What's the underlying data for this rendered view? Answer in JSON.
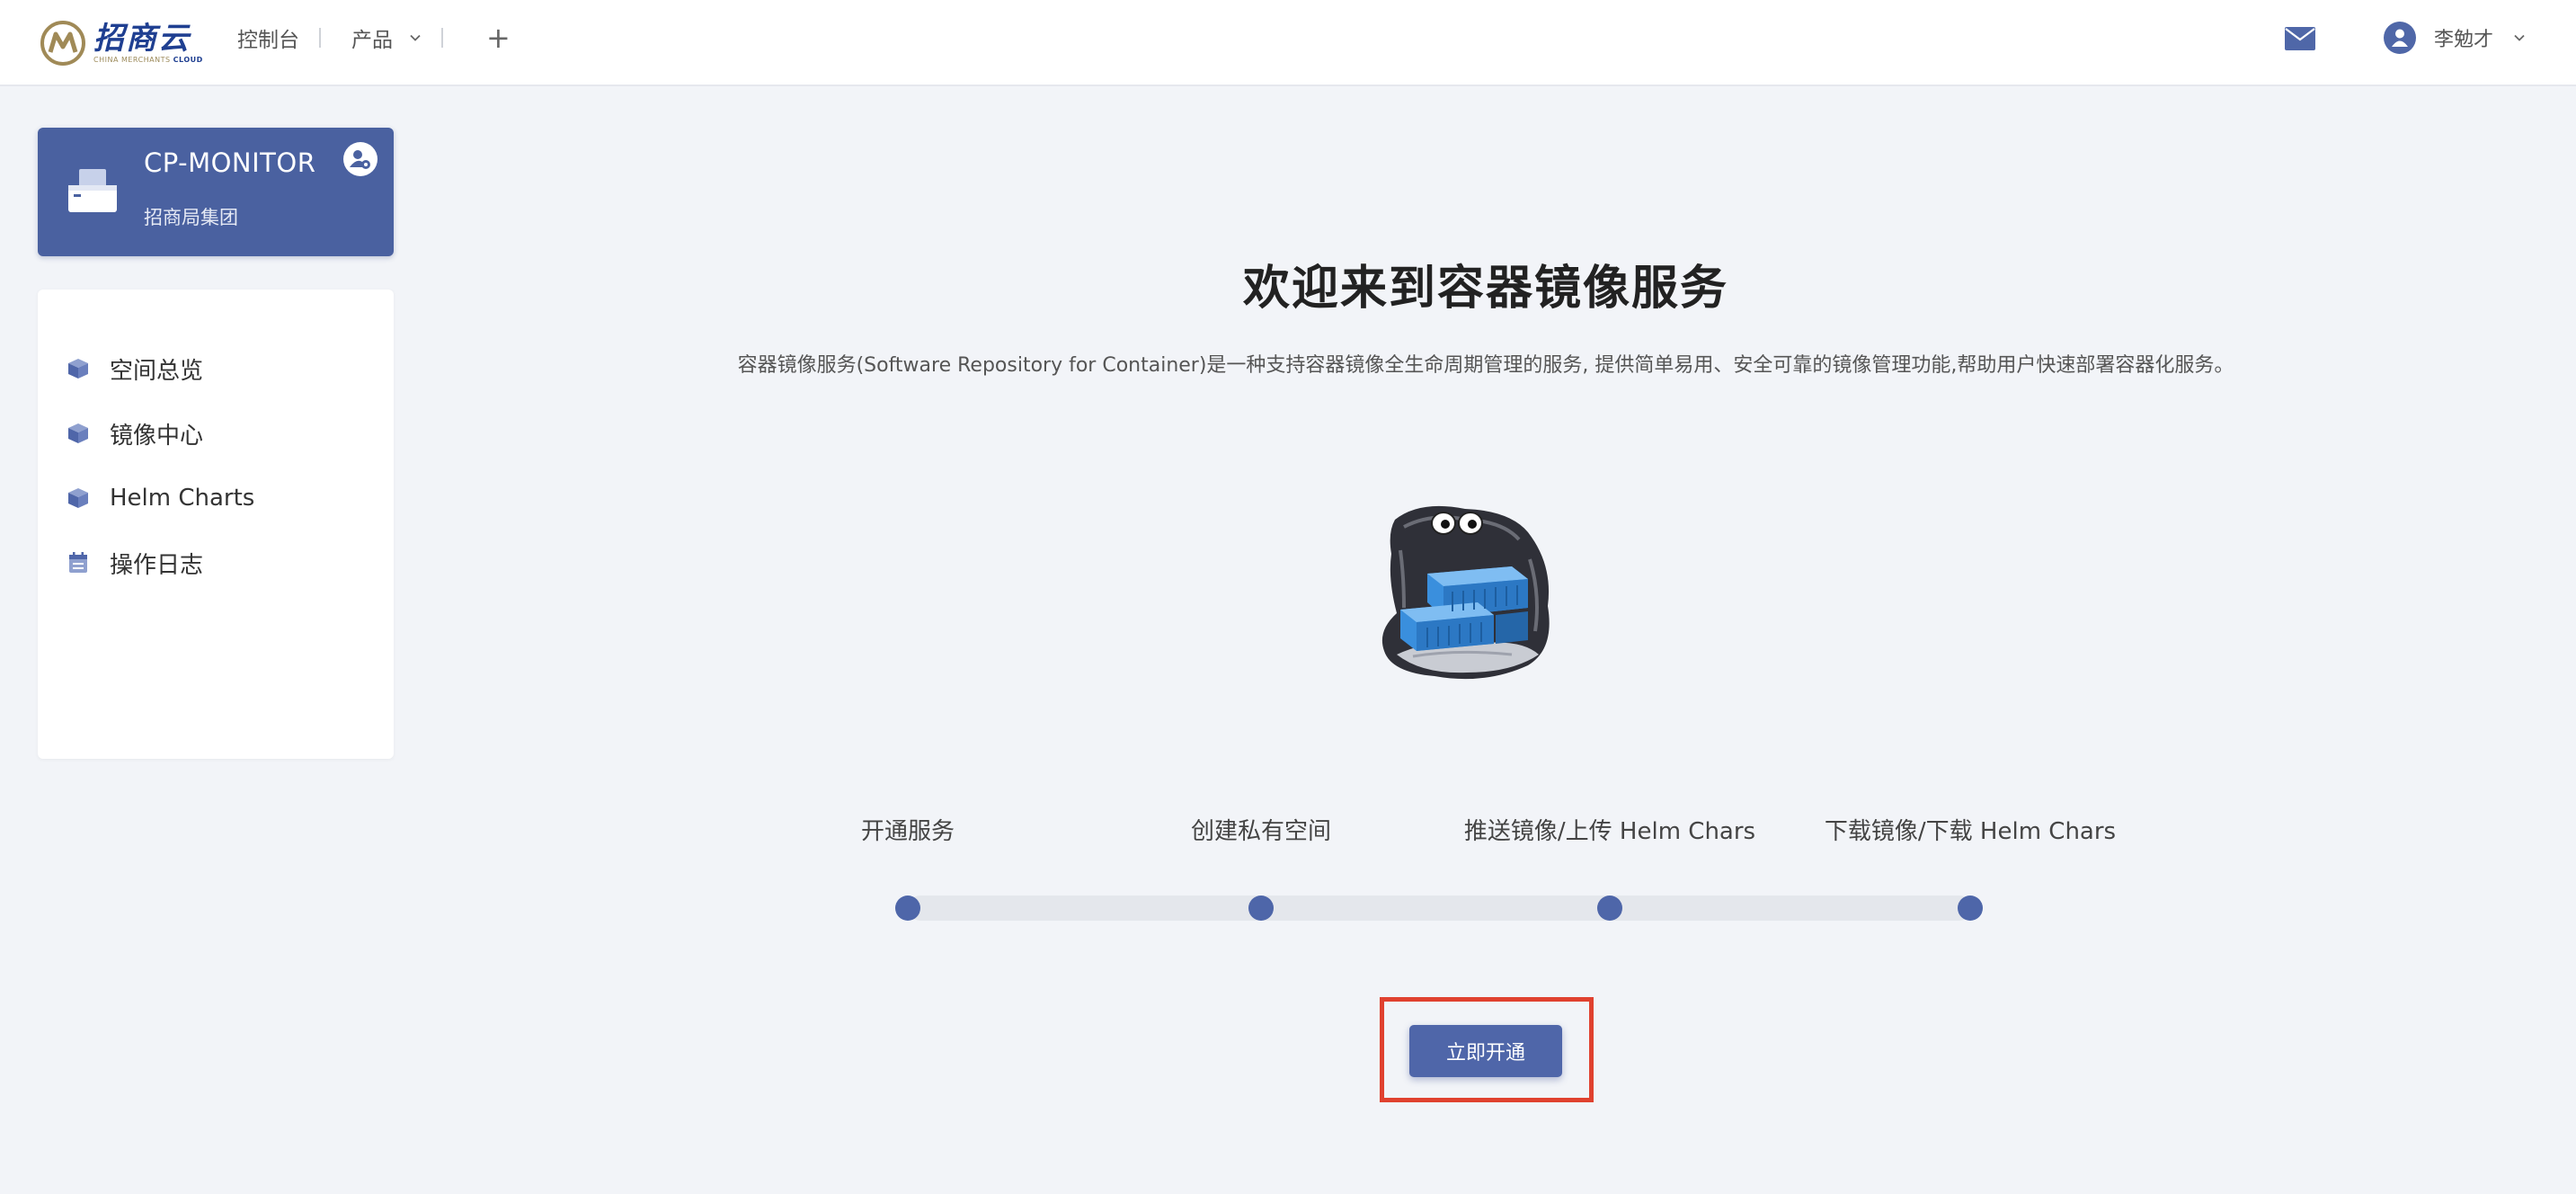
{
  "header": {
    "logo_cn": "招商云",
    "logo_en_prefix": "CHINA MERCHANTS",
    "logo_en_suffix": "CLOUD",
    "nav": {
      "console": "控制台",
      "products": "产品",
      "add": "+"
    },
    "user_name": "李勉才"
  },
  "project": {
    "name": "CP-MONITOR",
    "org": "招商局集团"
  },
  "sidebar": {
    "items": [
      {
        "label": "空间总览"
      },
      {
        "label": "镜像中心"
      },
      {
        "label": "Helm Charts"
      },
      {
        "label": "操作日志"
      }
    ]
  },
  "main": {
    "title": "欢迎来到容器镜像服务",
    "description": "容器镜像服务(Software Repository for Container)是一种支持容器镜像全生命周期管理的服务, 提供简单易用、安全可靠的镜像管理功能,帮助用户快速部署容器化服务。",
    "steps": [
      {
        "label": "开通服务"
      },
      {
        "label": "创建私有空间"
      },
      {
        "label": "推送镜像/上传 Helm Chars"
      },
      {
        "label": "下载镜像/下载 Helm Chars"
      }
    ],
    "cta_label": "立即开通"
  },
  "colors": {
    "primary": "#4f66a9",
    "highlight": "#e0412f",
    "logo_blue": "#1f3f91",
    "logo_gold": "#9c8a5a"
  }
}
